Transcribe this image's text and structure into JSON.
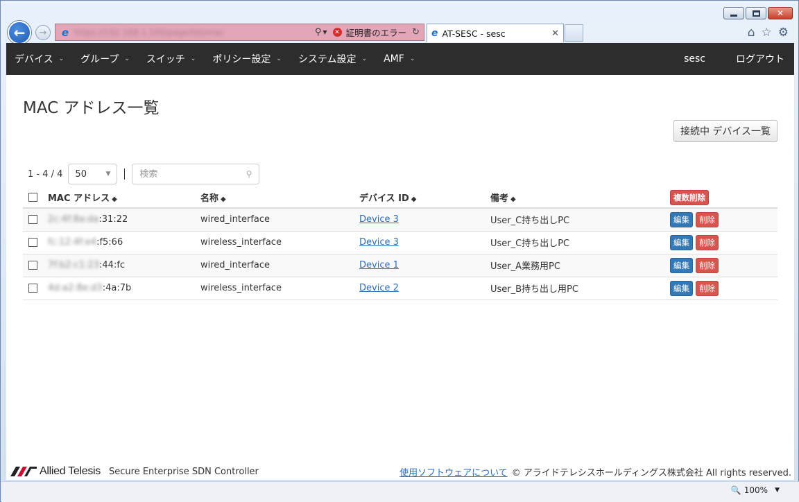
{
  "browser": {
    "url": "https://192.168.1.100/page/list/mac",
    "cert_error": "証明書のエラー",
    "tab_title": "AT-SESC - sesc",
    "zoom": "100%"
  },
  "nav": {
    "menu": [
      {
        "label": "デバイス"
      },
      {
        "label": "グループ"
      },
      {
        "label": "スイッチ"
      },
      {
        "label": "ポリシー設定"
      },
      {
        "label": "システム設定"
      },
      {
        "label": "AMF"
      }
    ],
    "user": "sesc",
    "logout": "ログアウト"
  },
  "page": {
    "title": "MAC アドレス一覧",
    "connected_devices_button": "接続中 デバイス一覧",
    "range": "1 - 4 / 4",
    "page_size": "50",
    "search_placeholder": "検索"
  },
  "table": {
    "headers": {
      "mac": "MAC アドレス",
      "name": "名称",
      "device_id": "デバイス ID",
      "note": "備考"
    },
    "bulk_delete": "複数削除",
    "edit_label": "編集",
    "delete_label": "削除",
    "rows": [
      {
        "mac_hidden": "2c:4f:8a:da",
        "mac_visible": ":31:22",
        "name": "wired_interface",
        "device": "Device 3",
        "note": "User_C持ち出しPC"
      },
      {
        "mac_hidden": "fc:12:4f:e4",
        "mac_visible": ":f5:66",
        "name": "wireless_interface",
        "device": "Device 3",
        "note": "User_C持ち出しPC"
      },
      {
        "mac_hidden": "7f:b2:c1:23",
        "mac_visible": ":44:fc",
        "name": "wired_interface",
        "device": "Device 1",
        "note": "User_A業務用PC"
      },
      {
        "mac_hidden": "4d:a2:8e:d3",
        "mac_visible": ":4a:7b",
        "name": "wireless_interface",
        "device": "Device 2",
        "note": "User_B持ち出し用PC"
      }
    ]
  },
  "footer": {
    "brand": "Allied Telesis",
    "product": "Secure Enterprise SDN Controller",
    "software_link": "使用ソフトウェアについて",
    "copyright": "© アライドテレシスホールディングス株式会社 All rights reserved."
  },
  "colors": {
    "navbar": "#2d2d2d",
    "primary": "#3379b7",
    "danger": "#d9534f",
    "link": "#2a6ebb",
    "address_bar_error": "#e2a6b7"
  }
}
